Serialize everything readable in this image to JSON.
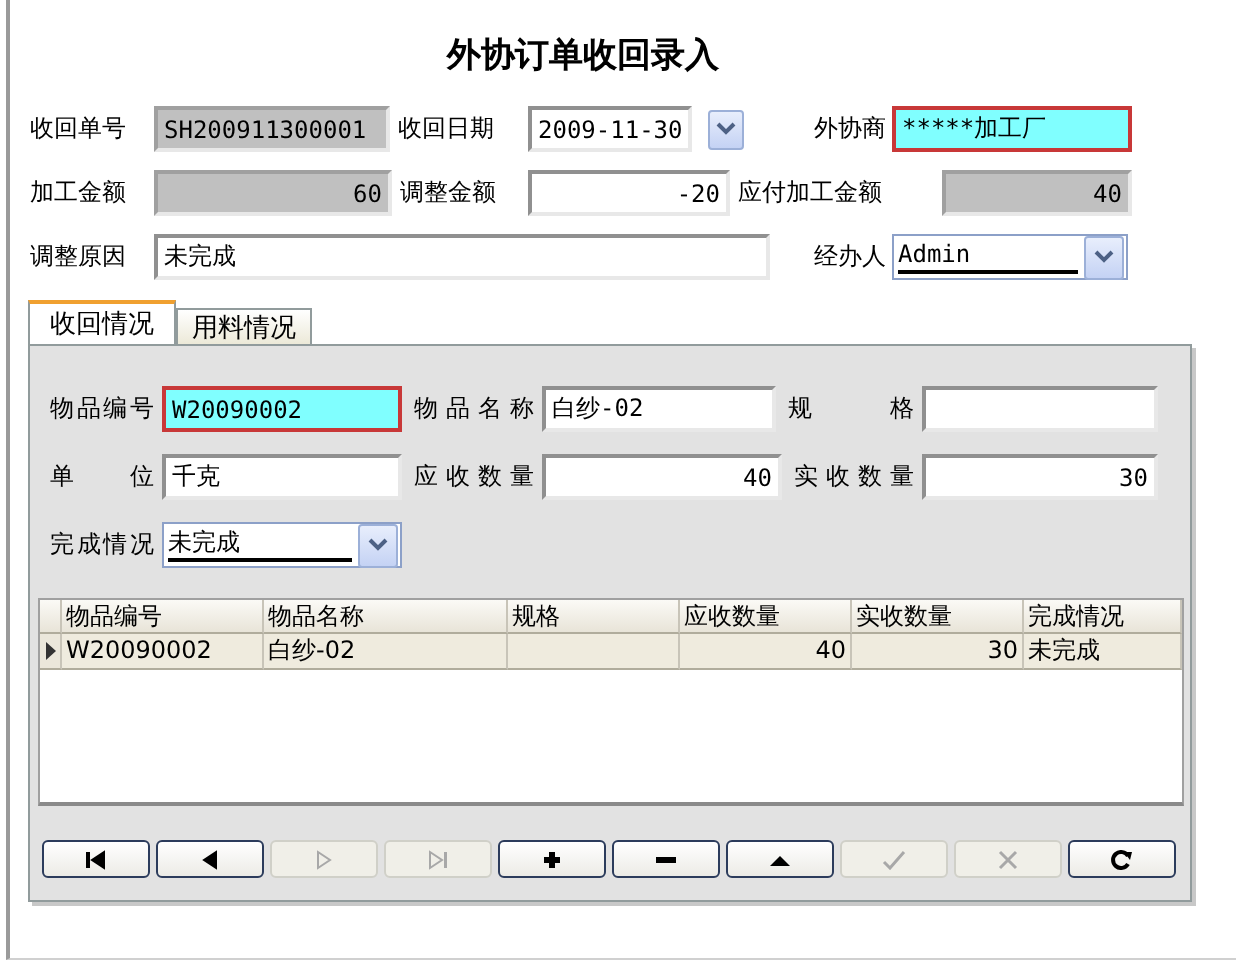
{
  "title": "外协订单收回录入",
  "header_rows": [
    [
      {
        "label": "收回单号",
        "value": "SH200911300001",
        "kind": "readonly"
      },
      {
        "label": "收回日期",
        "value": "2009-11-30",
        "kind": "date"
      },
      {
        "label": "外协商",
        "value": "*****加工厂",
        "kind": "required"
      }
    ],
    [
      {
        "label": "加工金额",
        "value": "60",
        "kind": "readonly",
        "numeric": true
      },
      {
        "label": "调整金额",
        "value": "-20",
        "kind": "normal",
        "numeric": true
      },
      {
        "label": "应付加工金额",
        "value": "40",
        "kind": "readonly",
        "numeric": true
      }
    ],
    [
      {
        "label": "调整原因",
        "value": "未完成",
        "kind": "normal"
      },
      {
        "label": "经办人",
        "value": "Admin",
        "kind": "combo"
      }
    ]
  ],
  "tabs": [
    {
      "label": "收回情况",
      "selected": true
    },
    {
      "label": "用料情况",
      "selected": false
    }
  ],
  "detail_rows": [
    [
      {
        "label": "物品编号",
        "value": "W20090002",
        "kind": "required"
      },
      {
        "label": "物品名称",
        "value": "白纱-02",
        "kind": "normal"
      },
      {
        "label": "规 格",
        "kind": "normal"
      }
    ],
    [
      {
        "label": "单 位",
        "value": "千克",
        "kind": "normal"
      },
      {
        "label": "应收数量",
        "value": "40",
        "kind": "normal",
        "numeric": true
      },
      {
        "label": "实收数量",
        "value": "30",
        "kind": "normal",
        "numeric": true
      }
    ],
    [
      {
        "label": "完成情况",
        "value": "未完成",
        "kind": "combo"
      }
    ]
  ],
  "table": {
    "columns": [
      {
        "label": "物品编号"
      },
      {
        "label": "物品名称"
      },
      {
        "label": "规格"
      },
      {
        "label": "应收数量",
        "numeric": true
      },
      {
        "label": "实收数量",
        "numeric": true
      },
      {
        "label": "完成情况"
      }
    ],
    "rows": [
      {
        "cells": [
          "W20090002",
          "白纱-02",
          "",
          "40",
          "30",
          "未完成"
        ],
        "selected": true
      }
    ]
  },
  "nav_buttons": [
    {
      "kind": "first",
      "disabled": false
    },
    {
      "kind": "prior",
      "disabled": false
    },
    {
      "kind": "next",
      "disabled": true
    },
    {
      "kind": "last",
      "disabled": true
    },
    {
      "kind": "insert",
      "disabled": false
    },
    {
      "kind": "delete",
      "disabled": false
    },
    {
      "kind": "edit",
      "disabled": false
    },
    {
      "kind": "post",
      "disabled": true
    },
    {
      "kind": "cancel",
      "disabled": true
    },
    {
      "kind": "refresh",
      "disabled": false
    }
  ]
}
